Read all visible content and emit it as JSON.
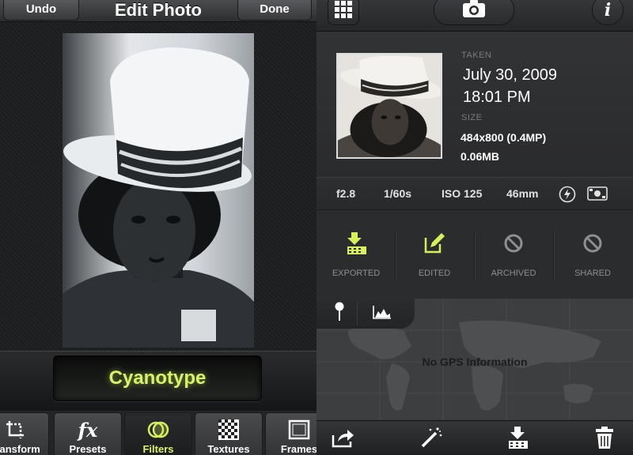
{
  "left_panel": {
    "title": "Edit Photo",
    "undo_label": "Undo",
    "done_label": "Done",
    "current_filter": "Cyanotype",
    "tabs": [
      {
        "label": "Transform",
        "icon": "crop-icon",
        "active": false
      },
      {
        "label": "Presets",
        "icon": "fx-icon",
        "active": false
      },
      {
        "label": "Filters",
        "icon": "filters-icon",
        "active": true
      },
      {
        "label": "Textures",
        "icon": "textures-icon",
        "active": false
      },
      {
        "label": "Frames",
        "icon": "frames-icon",
        "active": false
      }
    ],
    "fx_glyph": "fx"
  },
  "right_panel": {
    "top_icons": [
      "grid-icon",
      "camera-icon",
      "info-icon"
    ],
    "info_glyph": "i",
    "taken_label": "TAKEN",
    "date": "July 30, 2009",
    "time": "18:01 PM",
    "size_label": "SIZE",
    "dimensions": "484x800 (0.4MP)",
    "file_size": "0.06MB",
    "exif": {
      "aperture": "f2.8",
      "shutter": "1/60s",
      "iso": "ISO 125",
      "focal": "46mm"
    },
    "status_items": [
      {
        "label": "EXPORTED",
        "icon": "export-icon",
        "active": true
      },
      {
        "label": "EDITED",
        "icon": "edit-icon",
        "active": true
      },
      {
        "label": "ARCHIVED",
        "icon": "no-icon",
        "active": false
      },
      {
        "label": "SHARED",
        "icon": "no-icon",
        "active": false
      }
    ],
    "map_tabs": [
      "pin-icon",
      "histogram-icon"
    ],
    "no_gps": "No GPS Information",
    "bottom_icons": [
      "share-icon",
      "magic-wand-icon",
      "import-icon",
      "trash-icon"
    ]
  },
  "colors": {
    "accent": "#d8f26a",
    "active_icon": "#d6ef5a"
  }
}
